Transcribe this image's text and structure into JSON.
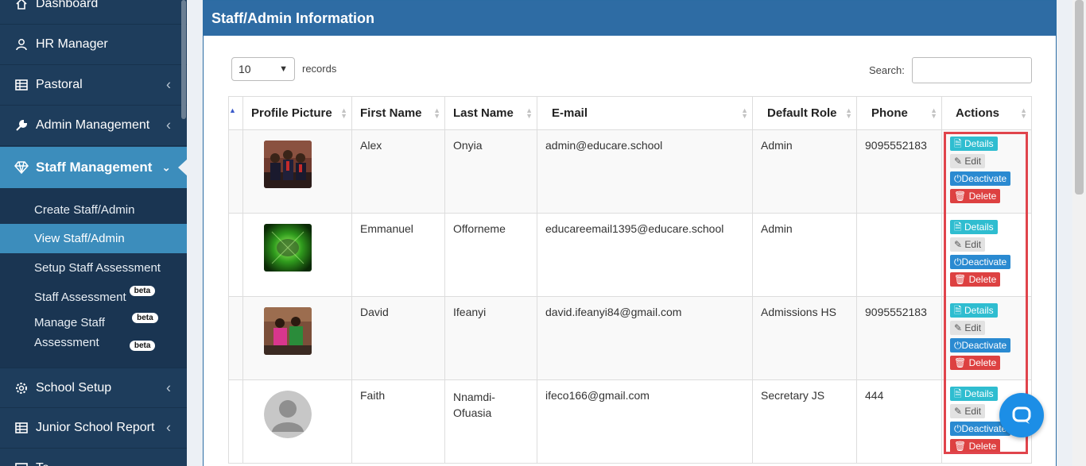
{
  "sidebar": {
    "items": [
      {
        "label": "Dashboard",
        "icon": "home-icon"
      },
      {
        "label": "HR Manager",
        "icon": "user-tie-icon"
      },
      {
        "label": "Pastoral",
        "icon": "table-icon"
      },
      {
        "label": "Admin Management",
        "icon": "wrench-icon"
      },
      {
        "label": "Staff Management",
        "icon": "diamond-icon"
      },
      {
        "label": "School Setup",
        "icon": "gear-icon"
      },
      {
        "label": "Junior School Report",
        "icon": "table-icon"
      },
      {
        "label": "Te",
        "icon": "table-icon"
      }
    ],
    "subitems": [
      {
        "label": "Create Staff/Admin"
      },
      {
        "label": "View Staff/Admin"
      },
      {
        "label": "Setup Staff Assessment"
      },
      {
        "label": "Staff Assessment",
        "badge": "beta"
      },
      {
        "label": "Manage Staff",
        "label2": "Assessment",
        "badge": "beta",
        "badge2": "beta"
      }
    ]
  },
  "panel": {
    "title": "Staff/Admin Information",
    "length_value": "10",
    "records_label": "records",
    "search_label": "Search:",
    "search_value": ""
  },
  "table": {
    "headers": [
      "Profile Picture",
      "First Name",
      "Last Name",
      "E-mail",
      "Default Role",
      "Phone",
      "Actions"
    ],
    "rows": [
      {
        "first": "Alex",
        "last": "Onyia",
        "email": "admin@educare.school",
        "role": "Admin",
        "phone": "9095552183"
      },
      {
        "first": "Emmanuel",
        "last": "Offorneme",
        "email": "educareemail1395@educare.school",
        "role": "Admin",
        "phone": ""
      },
      {
        "first": "David",
        "last": "Ifeanyi",
        "email": "david.ifeanyi84@gmail.com",
        "role": "Admissions HS",
        "phone": "9095552183"
      },
      {
        "first": "Faith",
        "last": "Nnamdi-Ofuasia",
        "email": "ifeco166@gmail.com",
        "role": "Secretary JS",
        "phone": "444"
      }
    ],
    "actions": {
      "details": "Details",
      "edit": "Edit",
      "deactivate": "Deactivate",
      "delete": "Delete"
    }
  },
  "colors": {
    "sidebar_bg": "#1e3d5c",
    "accent": "#3c8dbc",
    "details": "#2fbdd0",
    "deactivate": "#2a8ad1",
    "delete": "#dd4141",
    "highlight_box": "#e0444c"
  }
}
